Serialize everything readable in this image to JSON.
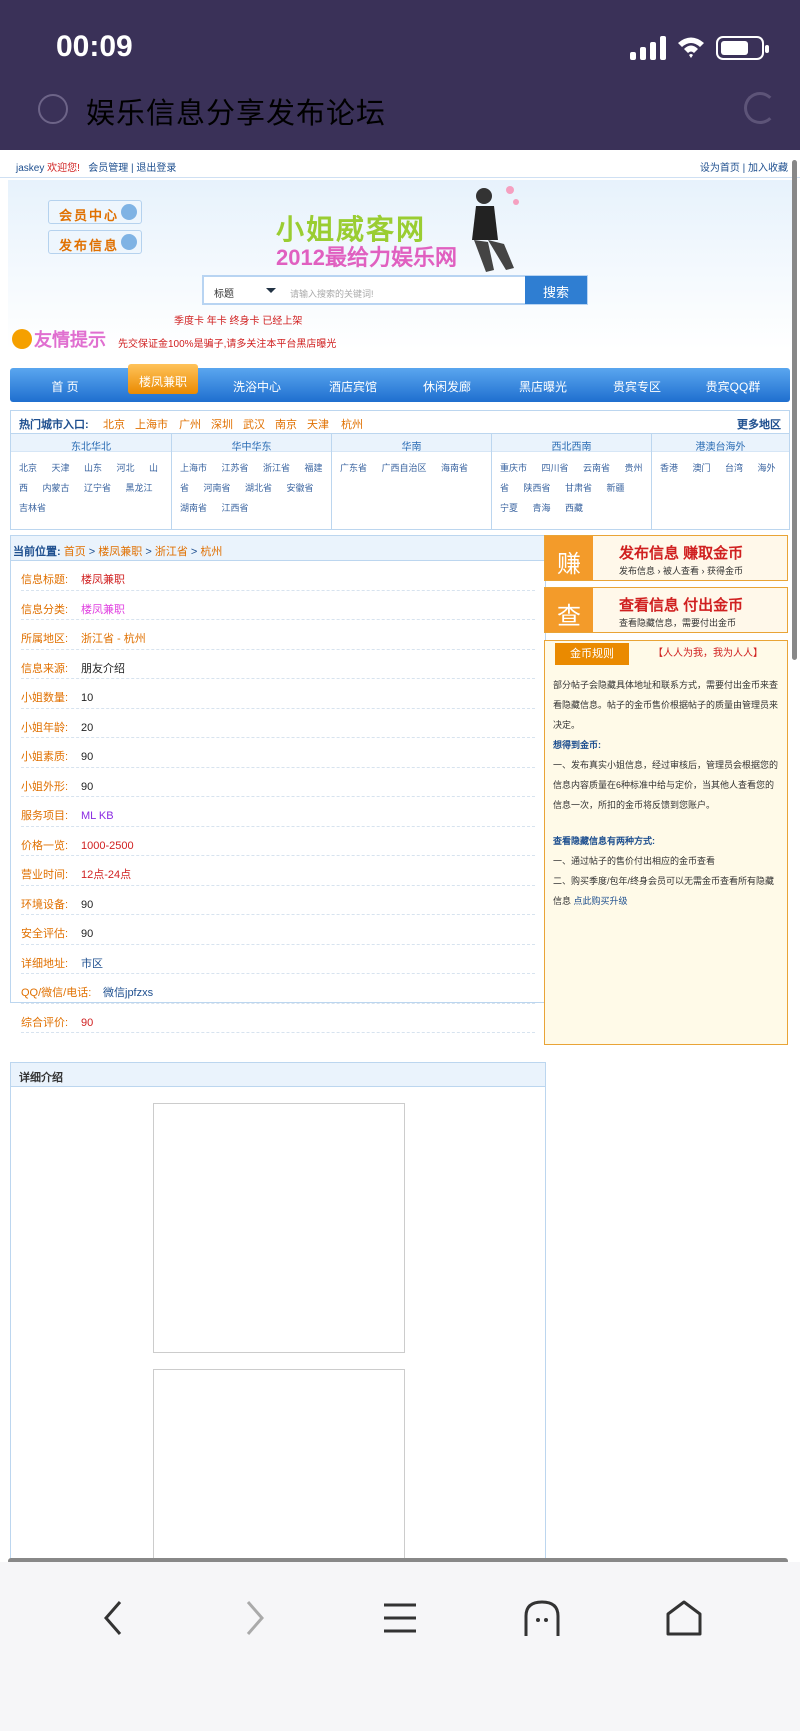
{
  "status": {
    "time": "00:09"
  },
  "browser": {
    "title": "娱乐信息分享发布论坛"
  },
  "topbar": {
    "user": "jaskey",
    "welcome": "欢迎您!",
    "manage": "会员管理",
    "logout": "退出登录",
    "home": "设为首页",
    "fav": "加入收藏"
  },
  "header": {
    "member": "会员中心",
    "post": "发布信息",
    "logo1": "小姐威客网",
    "logo2": "2012最给力娱乐网",
    "select": "标题",
    "placeholder": "请输入搜索的关键词!",
    "search": "搜索",
    "cards": "季度卡 年卡 终身卡 已经上架"
  },
  "notice": {
    "title": "友情提示",
    "text": "先交保证金100%是骗子,请多关注本平台黑店曝光"
  },
  "nav": [
    "首 页",
    "楼凤兼职",
    "洗浴中心",
    "酒店宾馆",
    "休闲发廊",
    "黑店曝光",
    "贵宾专区",
    "贵宾QQ群"
  ],
  "hot": {
    "label": "热门城市入口:",
    "cities": [
      "北京",
      "上海市",
      "广州",
      "深圳",
      "武汉",
      "南京",
      "天津",
      "杭州"
    ],
    "more": "更多地区"
  },
  "regions": [
    {
      "name": "东北华北",
      "places": "北京 天津 山东 河北 山西 内蒙古 辽宁省 黑龙江 吉林省"
    },
    {
      "name": "华中华东",
      "places": "上海市 江苏省 浙江省 福建省 河南省 湖北省 安徽省 湖南省 江西省"
    },
    {
      "name": "华南",
      "places": "广东省 广西自治区 海南省"
    },
    {
      "name": "西北西南",
      "places": "重庆市 四川省 云南省 贵州省 陕西省 甘肃省 新疆 宁夏 青海 西藏"
    },
    {
      "name": "港澳台海外",
      "places": "香港 澳门 台湾 海外"
    }
  ],
  "crumb": {
    "label": "当前位置:",
    "items": [
      "首页",
      "楼凤兼职",
      "浙江省",
      "杭州"
    ]
  },
  "info": [
    {
      "k": "信息标题:",
      "v": "楼凤兼职",
      "c": "#d02020"
    },
    {
      "k": "信息分类:",
      "v": "楼凤兼职",
      "c": "#e040e0"
    },
    {
      "k": "所属地区:",
      "v": "浙江省 - 杭州",
      "c": "#e07000"
    },
    {
      "k": "信息来源:",
      "v": "朋友介绍",
      "c": "#222"
    },
    {
      "k": "小姐数量:",
      "v": "10",
      "c": "#222"
    },
    {
      "k": "小姐年龄:",
      "v": "20",
      "c": "#222"
    },
    {
      "k": "小姐素质:",
      "v": "90",
      "c": "#222"
    },
    {
      "k": "小姐外形:",
      "v": "90",
      "c": "#222"
    },
    {
      "k": "服务项目:",
      "v": "ML KB",
      "c": "#8a2be2"
    },
    {
      "k": "价格一览:",
      "v": "1000-2500",
      "c": "#d02020"
    },
    {
      "k": "营业时间:",
      "v": "12点-24点",
      "c": "#d02020"
    },
    {
      "k": "环境设备:",
      "v": "90",
      "c": "#222"
    },
    {
      "k": "安全评估:",
      "v": "90",
      "c": "#222"
    },
    {
      "k": "详细地址:",
      "v": "市区",
      "c": "#1e4f8f"
    },
    {
      "k": "QQ/微信/电话:",
      "v": "微信jpfzxs",
      "c": "#1e4f8f"
    },
    {
      "k": "综合评价:",
      "v": "90",
      "c": "#d02020"
    }
  ],
  "earn": [
    {
      "icon": "赚",
      "a": "发布信息 赚取金币",
      "b": "发布信息 › 被人查看 › 获得金币"
    },
    {
      "icon": "查",
      "a": "查看信息 付出金币",
      "b": "查看隐藏信息，需要付出金币"
    }
  ],
  "rules": {
    "tab": "金币规则",
    "tag": "【人人为我，我为人人】",
    "p1": "部分帖子会隐藏具体地址和联系方式，需要付出金币来查看隐藏信息。帖子的金币售价根据帖子的质量由管理员来决定。",
    "h1": "想得到金币:",
    "p2": "一、发布真实小姐信息，经过审核后，管理员会根据您的信息内容质量在6种标准中给与定价，当其他人查看您的信息一次，所扣的金币将反馈到您账户。",
    "h2": "查看隐藏信息有两种方式:",
    "p3": "一、通过帖子的售价付出相应的金币查看",
    "p4": "二、购买季度/包年/终身会员可以无需金币查看所有隐藏信息",
    "link": "点此购买升级"
  },
  "detail": {
    "title": "详细介绍"
  }
}
